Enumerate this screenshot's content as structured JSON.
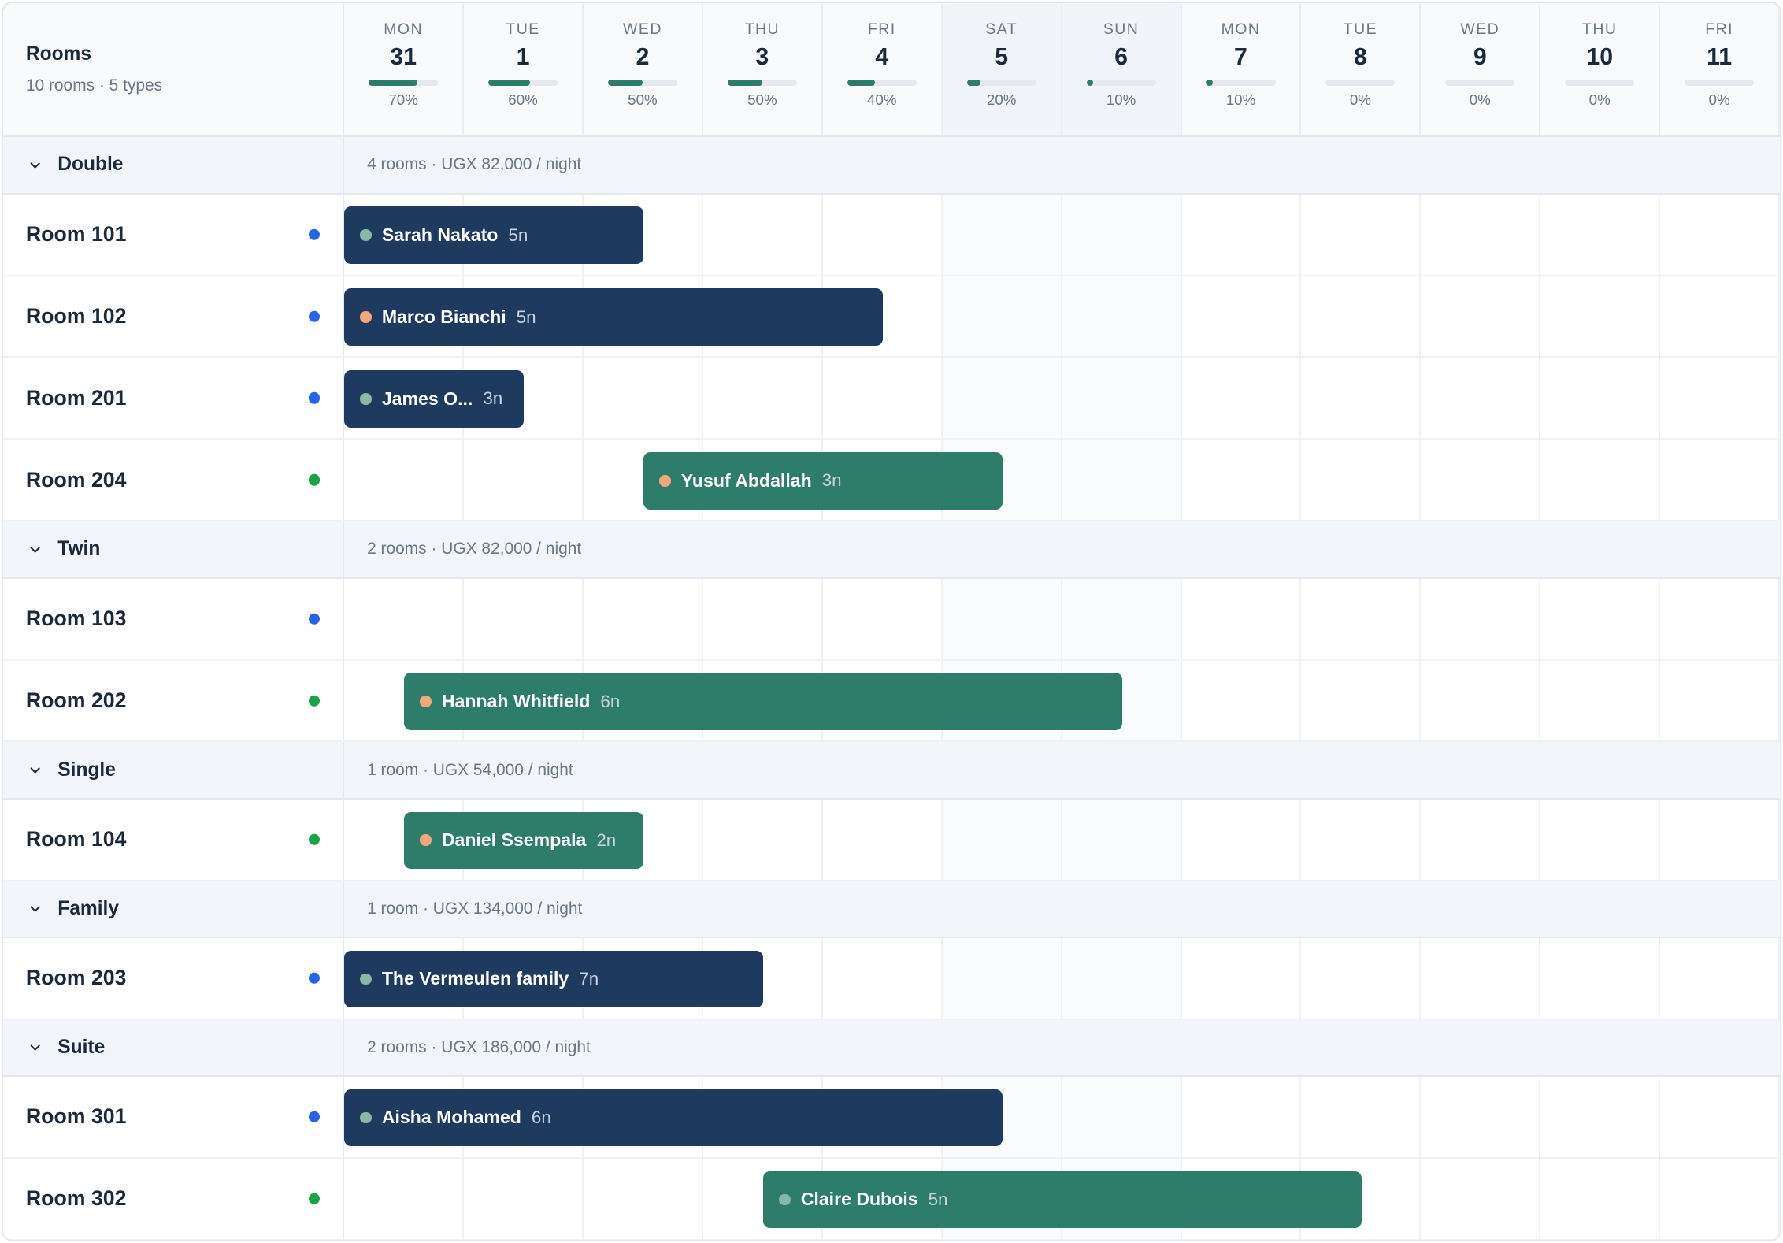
{
  "header": {
    "title": "Rooms",
    "subtitle": "10 rooms · 5 types"
  },
  "days": [
    {
      "name": "MON",
      "num": "31",
      "occ": 70,
      "occ_label": "70%",
      "weekend": false
    },
    {
      "name": "TUE",
      "num": "1",
      "occ": 60,
      "occ_label": "60%",
      "weekend": false
    },
    {
      "name": "WED",
      "num": "2",
      "occ": 50,
      "occ_label": "50%",
      "weekend": false
    },
    {
      "name": "THU",
      "num": "3",
      "occ": 50,
      "occ_label": "50%",
      "weekend": false
    },
    {
      "name": "FRI",
      "num": "4",
      "occ": 40,
      "occ_label": "40%",
      "weekend": false
    },
    {
      "name": "SAT",
      "num": "5",
      "occ": 20,
      "occ_label": "20%",
      "weekend": true
    },
    {
      "name": "SUN",
      "num": "6",
      "occ": 10,
      "occ_label": "10%",
      "weekend": true
    },
    {
      "name": "MON",
      "num": "7",
      "occ": 10,
      "occ_label": "10%",
      "weekend": false
    },
    {
      "name": "TUE",
      "num": "8",
      "occ": 0,
      "occ_label": "0%",
      "weekend": false
    },
    {
      "name": "WED",
      "num": "9",
      "occ": 0,
      "occ_label": "0%",
      "weekend": false
    },
    {
      "name": "THU",
      "num": "10",
      "occ": 0,
      "occ_label": "0%",
      "weekend": false
    },
    {
      "name": "FRI",
      "num": "11",
      "occ": 0,
      "occ_label": "0%",
      "weekend": false
    }
  ],
  "groups": [
    {
      "name": "Double",
      "info": "4 rooms · UGX 82,000 / night",
      "rooms": [
        {
          "name": "Room 101",
          "status": "blue",
          "booking": {
            "guest": "Sarah Nakato",
            "nights": "5n",
            "color": "navy",
            "dot": "sage",
            "start": 0,
            "span": 2.5
          }
        },
        {
          "name": "Room 102",
          "status": "blue",
          "booking": {
            "guest": "Marco Bianchi",
            "nights": "5n",
            "color": "navy",
            "dot": "peach",
            "start": 0,
            "span": 4.5
          }
        },
        {
          "name": "Room 201",
          "status": "blue",
          "booking": {
            "guest": "James O...",
            "nights": "3n",
            "color": "navy",
            "dot": "sage",
            "start": 0,
            "span": 1.5
          }
        },
        {
          "name": "Room 204",
          "status": "green",
          "booking": {
            "guest": "Yusuf Abdallah",
            "nights": "3n",
            "color": "teal",
            "dot": "peach",
            "start": 2.5,
            "span": 3.0
          }
        }
      ]
    },
    {
      "name": "Twin",
      "info": "2 rooms · UGX 82,000 / night",
      "rooms": [
        {
          "name": "Room 103",
          "status": "blue",
          "booking": null
        },
        {
          "name": "Room 202",
          "status": "green",
          "booking": {
            "guest": "Hannah Whitfield",
            "nights": "6n",
            "color": "teal",
            "dot": "peach",
            "start": 0.5,
            "span": 6.0
          }
        }
      ]
    },
    {
      "name": "Single",
      "info": "1 room · UGX 54,000 / night",
      "rooms": [
        {
          "name": "Room 104",
          "status": "green",
          "booking": {
            "guest": "Daniel Ssempala",
            "nights": "2n",
            "color": "teal",
            "dot": "peach",
            "start": 0.5,
            "span": 2.0
          }
        }
      ]
    },
    {
      "name": "Family",
      "info": "1 room · UGX 134,000 / night",
      "rooms": [
        {
          "name": "Room 203",
          "status": "blue",
          "booking": {
            "guest": "The Vermeulen family",
            "nights": "7n",
            "color": "navy",
            "dot": "sage",
            "start": 0,
            "span": 3.5
          }
        }
      ]
    },
    {
      "name": "Suite",
      "info": "2 rooms · UGX 186,000 / night",
      "rooms": [
        {
          "name": "Room 301",
          "status": "blue",
          "booking": {
            "guest": "Aisha Mohamed",
            "nights": "6n",
            "color": "navy",
            "dot": "sage",
            "start": 0,
            "span": 5.5
          }
        },
        {
          "name": "Room 302",
          "status": "green",
          "booking": {
            "guest": "Claire Dubois",
            "nights": "5n",
            "color": "teal",
            "dot": "sage",
            "start": 3.5,
            "span": 5.0
          }
        }
      ]
    }
  ],
  "colors": {
    "navy": "#1f3a5f",
    "teal": "#2e7d6b",
    "blue": "#2563eb",
    "green": "#16a34a",
    "peach": "#f4a77c",
    "sage": "#8ab8a6"
  }
}
